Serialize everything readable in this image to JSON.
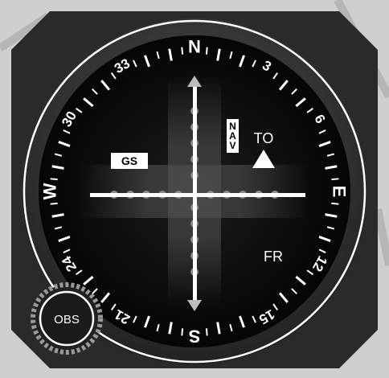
{
  "instrument": {
    "cardinals": {
      "north": "N",
      "east": "E",
      "south": "S",
      "west": "W"
    },
    "numerals": [
      "3",
      "6",
      "12",
      "15",
      "21",
      "24",
      "30",
      "33"
    ],
    "flags": {
      "gs": "GS",
      "nav": "NAV",
      "to": "TO",
      "from": "FR"
    },
    "knob_label": "OBS"
  },
  "colors": {
    "face": "#0b0b0b",
    "bezel": "#3a3a3a",
    "background": "#cfcfcf",
    "markings": "#ffffff"
  }
}
